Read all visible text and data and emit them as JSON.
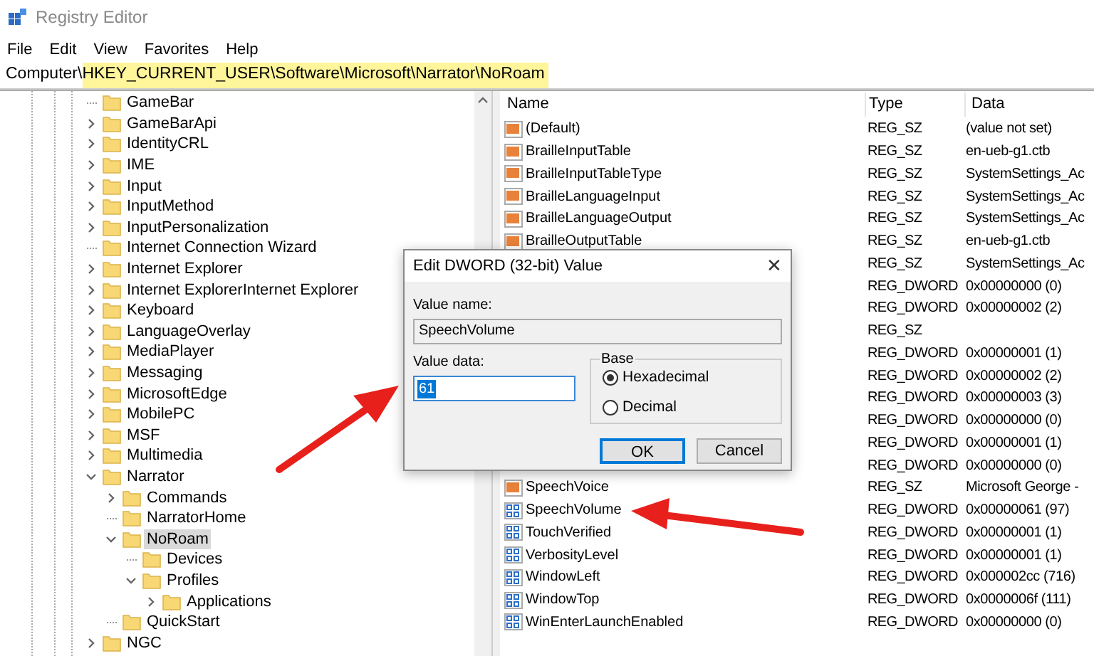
{
  "window": {
    "title": "Registry Editor"
  },
  "menu": [
    "File",
    "Edit",
    "View",
    "Favorites",
    "Help"
  ],
  "address": {
    "prefix": "Computer\\",
    "highlighted": "HKEY_CURRENT_USER\\Software\\Microsoft\\Narrator\\NoRoam"
  },
  "tree": [
    {
      "label": "GameBar",
      "expandable": false,
      "selected": false
    },
    {
      "label": "GameBarApi",
      "expandable": true,
      "expanded": false,
      "selected": false
    },
    {
      "label": "IdentityCRL",
      "expandable": true,
      "expanded": false,
      "selected": false
    },
    {
      "label": "IME",
      "expandable": true,
      "expanded": false,
      "selected": false
    },
    {
      "label": "Input",
      "expandable": true,
      "expanded": false,
      "selected": false
    },
    {
      "label": "InputMethod",
      "expandable": true,
      "expanded": false,
      "selected": false
    },
    {
      "label": "InputPersonalization",
      "expandable": true,
      "expanded": false,
      "selected": false
    },
    {
      "label": "Internet Connection Wizard",
      "expandable": false,
      "selected": false
    },
    {
      "label": "Internet Explorer",
      "expandable": true,
      "expanded": false,
      "selected": false
    },
    {
      "label": "Internet ExplorerInternet Explorer",
      "expandable": true,
      "expanded": false,
      "selected": false
    },
    {
      "label": "Keyboard",
      "expandable": true,
      "expanded": false,
      "selected": false
    },
    {
      "label": "LanguageOverlay",
      "expandable": true,
      "expanded": false,
      "selected": false
    },
    {
      "label": "MediaPlayer",
      "expandable": true,
      "expanded": false,
      "selected": false
    },
    {
      "label": "Messaging",
      "expandable": true,
      "expanded": false,
      "selected": false
    },
    {
      "label": "MicrosoftEdge",
      "expandable": true,
      "expanded": false,
      "selected": false
    },
    {
      "label": "MobilePC",
      "expandable": true,
      "expanded": false,
      "selected": false
    },
    {
      "label": "MSF",
      "expandable": true,
      "expanded": false,
      "selected": false
    },
    {
      "label": "Multimedia",
      "expandable": true,
      "expanded": false,
      "selected": false
    },
    {
      "label": "Narrator",
      "expandable": true,
      "expanded": true,
      "selected": false,
      "children": [
        {
          "label": "Commands",
          "expandable": true,
          "expanded": false,
          "selected": false
        },
        {
          "label": "NarratorHome",
          "expandable": false,
          "selected": false
        },
        {
          "label": "NoRoam",
          "expandable": true,
          "expanded": true,
          "selected": true,
          "children": [
            {
              "label": "Devices",
              "expandable": false,
              "selected": false
            },
            {
              "label": "Profiles",
              "expandable": true,
              "expanded": true,
              "selected": false,
              "children": [
                {
                  "label": "Applications",
                  "expandable": true,
                  "expanded": false,
                  "selected": false
                }
              ]
            }
          ]
        },
        {
          "label": "QuickStart",
          "expandable": false,
          "selected": false
        }
      ]
    },
    {
      "label": "NGC",
      "expandable": true,
      "expanded": false,
      "selected": false
    }
  ],
  "table": {
    "columns": [
      "Name",
      "Type",
      "Data"
    ],
    "rows": [
      {
        "kind": "string",
        "name": "(Default)",
        "type": "REG_SZ",
        "data": "(value not set)"
      },
      {
        "kind": "string",
        "name": "BrailleInputTable",
        "type": "REG_SZ",
        "data": "en-ueb-g1.ctb"
      },
      {
        "kind": "string",
        "name": "BrailleInputTableType",
        "type": "REG_SZ",
        "data": "SystemSettings_Ac"
      },
      {
        "kind": "string",
        "name": "BrailleLanguageInput",
        "type": "REG_SZ",
        "data": "SystemSettings_Ac"
      },
      {
        "kind": "string",
        "name": "BrailleLanguageOutput",
        "type": "REG_SZ",
        "data": "SystemSettings_Ac"
      },
      {
        "kind": "string",
        "name": "BrailleOutputTable",
        "type": "REG_SZ",
        "data": "en-ueb-g1.ctb"
      },
      {
        "type": "REG_SZ",
        "data": "SystemSettings_Ac"
      },
      {
        "type": "REG_DWORD",
        "data": "0x00000000 (0)"
      },
      {
        "type": "REG_DWORD",
        "data": "0x00000002 (2)"
      },
      {
        "type": "REG_SZ"
      },
      {
        "type": "REG_DWORD",
        "data": "0x00000001 (1)"
      },
      {
        "type": "REG_DWORD",
        "data": "0x00000002 (2)"
      },
      {
        "type": "REG_DWORD",
        "data": "0x00000003 (3)"
      },
      {
        "type": "REG_DWORD",
        "data": "0x00000000 (0)"
      },
      {
        "type": "REG_DWORD",
        "data": "0x00000001 (1)"
      },
      {
        "type": "REG_DWORD",
        "data": "0x00000000 (0)"
      },
      {
        "kind": "string",
        "name": "SpeechVoice",
        "type": "REG_SZ",
        "data": "Microsoft George -"
      },
      {
        "kind": "dword",
        "name": "SpeechVolume",
        "type": "REG_DWORD",
        "data": "0x00000061 (97)"
      },
      {
        "kind": "dword",
        "name": "TouchVerified",
        "type": "REG_DWORD",
        "data": "0x00000001 (1)"
      },
      {
        "kind": "dword",
        "name": "VerbosityLevel",
        "type": "REG_DWORD",
        "data": "0x00000001 (1)"
      },
      {
        "kind": "dword",
        "name": "WindowLeft",
        "type": "REG_DWORD",
        "data": "0x000002cc (716)"
      },
      {
        "kind": "dword",
        "name": "WindowTop",
        "type": "REG_DWORD",
        "data": "0x0000006f (111)"
      },
      {
        "kind": "dword",
        "name": "WinEnterLaunchEnabled",
        "type": "REG_DWORD",
        "data": "0x00000000 (0)"
      }
    ]
  },
  "dialog": {
    "title": "Edit DWORD (32-bit) Value",
    "close": "✕",
    "value_name_label": "Value name:",
    "value_name": "SpeechVolume",
    "value_data_label": "Value data:",
    "value_data": "61",
    "base_label": "Base",
    "base_options": [
      {
        "label": "Hexadecimal",
        "selected": true
      },
      {
        "label": "Decimal",
        "selected": false
      }
    ],
    "buttons": [
      {
        "label": "OK",
        "focused": true
      },
      {
        "label": "Cancel",
        "focused": false
      }
    ]
  }
}
